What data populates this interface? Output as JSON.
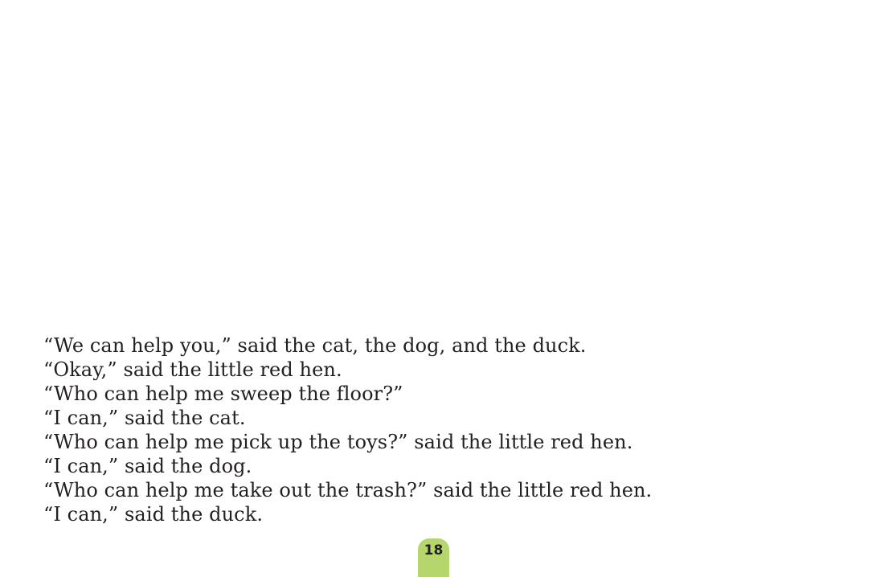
{
  "story": {
    "lines": [
      "“We can help you,” said the cat, the dog, and the duck.",
      "“Okay,” said the little red hen.",
      "“Who can help me sweep the floor?”",
      "“I can,” said the cat.",
      "“Who can help me pick up the toys?” said the little red hen.",
      "“I can,” said the dog.",
      "“Who can help me take out the trash?” said the little red hen.",
      "“I can,” said the duck."
    ]
  },
  "footer": {
    "page_number": "18",
    "tab_color": "#b5d66c"
  }
}
